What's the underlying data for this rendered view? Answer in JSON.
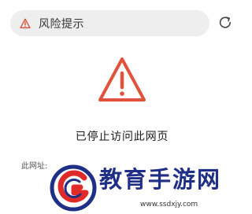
{
  "address_bar": {
    "text": "风险提示",
    "warning_icon": "warning-triangle-icon",
    "warning_color": "#e0533a"
  },
  "reload": {
    "icon": "reload-icon"
  },
  "main": {
    "big_icon": "warning-triangle-icon",
    "accent_color": "#e0533a",
    "title": "已停止访问此网页",
    "url_label": "此网址:"
  },
  "watermark": {
    "title": "教育手游网",
    "url": "www.ssdxjy.com",
    "brand_blue": "#1f2f86",
    "brand_red": "#e02a2a"
  }
}
